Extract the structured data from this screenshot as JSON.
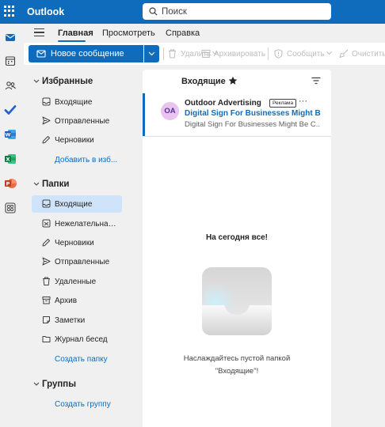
{
  "app": {
    "title": "Outlook"
  },
  "search": {
    "placeholder": "Поиск"
  },
  "rail": {
    "icons": [
      "mail-icon",
      "calendar-icon",
      "people-icon",
      "todo-icon",
      "word-icon",
      "excel-icon",
      "powerpoint-icon",
      "apps-icon"
    ]
  },
  "menu": {
    "tabs": [
      {
        "label": "Главная",
        "active": true
      },
      {
        "label": "Просмотреть",
        "active": false
      },
      {
        "label": "Справка",
        "active": false
      }
    ]
  },
  "ribbon": {
    "new_message": "Новое сообщение",
    "delete": "Удалить",
    "archive": "Архивировать",
    "report": "Сообщить",
    "sweep": "Очистить"
  },
  "favorites": {
    "title": "Избранные",
    "items": [
      "Входящие",
      "Отправленные",
      "Черновики"
    ],
    "add_link": "Добавить в изб..."
  },
  "folders": {
    "title": "Папки",
    "items": [
      "Входящие",
      "Нежелательная ...",
      "Черновики",
      "Отправленные",
      "Удаленные",
      "Архив",
      "Заметки",
      "Журнал бесед"
    ],
    "create_link": "Создать папку"
  },
  "groups": {
    "title": "Группы",
    "create_link": "Создать группу"
  },
  "message_list": {
    "title": "Входящие",
    "message": {
      "avatar": "OA",
      "sender": "Outdoor Advertising",
      "badge": "Реклама",
      "subject": "Digital Sign For Businesses Might Be ...",
      "preview": "Digital Sign For Businesses Might Be C..."
    },
    "empty_title": "На сегодня все!",
    "empty_message": "Наслаждайтесь пустой папкой \"Входящие\"!"
  },
  "colors": {
    "brand": "#0f6cbd",
    "selected": "#cfe4fa",
    "avatar_bg": "#e8c4ee"
  }
}
